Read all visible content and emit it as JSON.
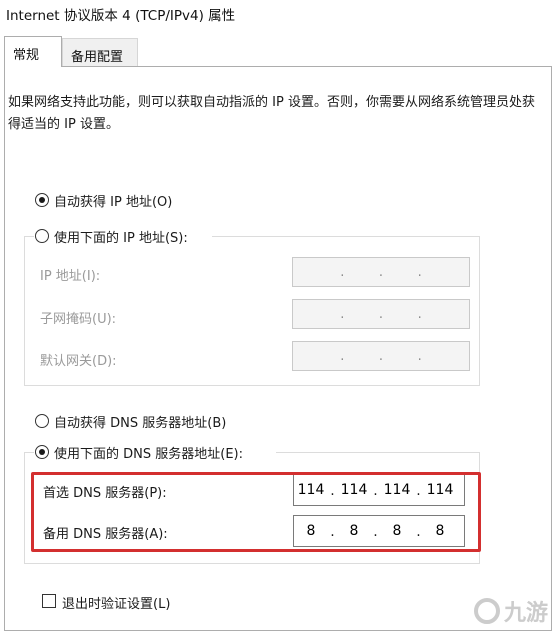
{
  "window": {
    "title": "Internet 协议版本 4 (TCP/IPv4) 属性"
  },
  "tabs": [
    {
      "label": "常规",
      "active": true
    },
    {
      "label": "备用配置",
      "active": false
    }
  ],
  "description": "如果网络支持此功能，则可以获取自动指派的 IP 设置。否则，你需要从网络系统管理员处获得适当的 IP 设置。",
  "ip": {
    "auto_label": "自动获得 IP 地址(O)",
    "auto_checked": true,
    "manual_label": "使用下面的 IP 地址(S):",
    "manual_checked": false,
    "fields": [
      {
        "label": "IP 地址(I):"
      },
      {
        "label": "子网掩码(U):"
      },
      {
        "label": "默认网关(D):"
      }
    ]
  },
  "dns": {
    "auto_label": "自动获得 DNS 服务器地址(B)",
    "auto_checked": false,
    "manual_label": "使用下面的 DNS 服务器地址(E):",
    "manual_checked": true,
    "preferred": {
      "label": "首选 DNS 服务器(P):",
      "octets": [
        "114",
        "114",
        "114",
        "114"
      ]
    },
    "alternate": {
      "label": "备用 DNS 服务器(A):",
      "octets": [
        "8",
        "8",
        "8",
        "8"
      ]
    }
  },
  "validate": {
    "label": "退出时验证设置(L)",
    "checked": false
  },
  "watermark": {
    "text": "九游"
  },
  "colors": {
    "highlight": "#d32f2f",
    "disabled_text": "#9a9a9a"
  }
}
